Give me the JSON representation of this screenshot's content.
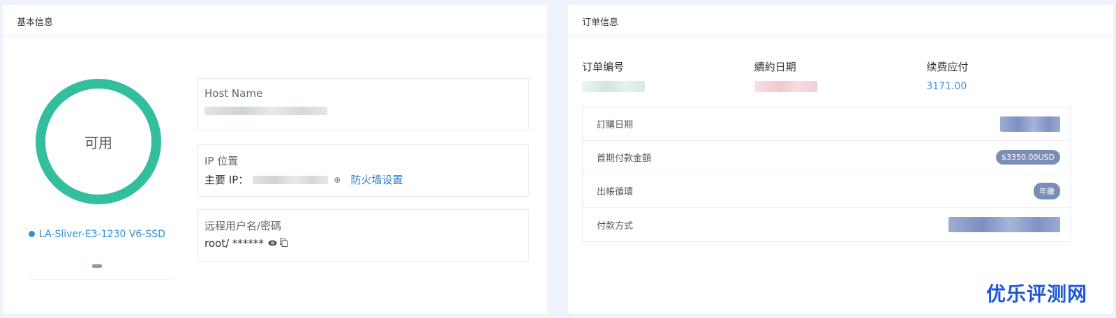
{
  "left_panel": {
    "title": "基本信息",
    "status": "可用",
    "plan_name": "LA-Sliver-E3-1230 V6-SSD",
    "host_label": "Host Name",
    "ip_label": "IP 位置",
    "ip_prefix": "主要 IP：",
    "firewall_link": "防火墙设置",
    "remote_label": "远程用户名/密碼",
    "remote_value": "root/ ******"
  },
  "right_panel": {
    "title": "订单信息",
    "order_no_label": "订单编号",
    "renew_date_label": "續約日期",
    "renew_fee_label": "续费应付",
    "renew_fee_value": "3171.00",
    "rows": [
      {
        "label": "訂購日期"
      },
      {
        "label": "首期付款金額",
        "badge": "$3350.00USD"
      },
      {
        "label": "出帳循環",
        "badge": "年繳"
      },
      {
        "label": "付款方式"
      }
    ]
  },
  "watermark": "优乐评测网",
  "colors": {
    "ring": "#33bf9e",
    "link": "#2f7fc0",
    "badge": "#7b8db6",
    "price": "#4a90d9"
  },
  "icons": [
    "plus-circle-icon",
    "eye-icon",
    "copy-icon"
  ]
}
